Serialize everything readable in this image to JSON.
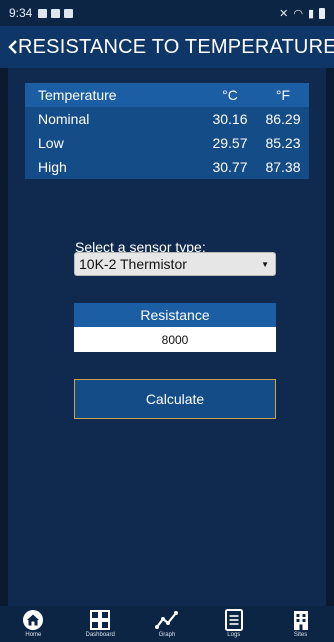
{
  "status_bar": {
    "time": "9:34"
  },
  "header": {
    "title": "RESISTANCE TO TEMPERATURE"
  },
  "table": {
    "headers": [
      "Temperature",
      "°C",
      "°F"
    ],
    "rows": [
      {
        "label": "Nominal",
        "c": "30.16",
        "f": "86.29"
      },
      {
        "label": "Low",
        "c": "29.57",
        "f": "85.23"
      },
      {
        "label": "High",
        "c": "30.77",
        "f": "87.38"
      }
    ]
  },
  "sensor": {
    "label": "Select a sensor type:",
    "selected": "10K-2 Thermistor"
  },
  "resistance": {
    "label": "Resistance",
    "value": "8000"
  },
  "calculate": {
    "label": "Calculate"
  },
  "nav": [
    {
      "label": "Home",
      "icon": "home-icon"
    },
    {
      "label": "Dashboard",
      "icon": "dashboard-icon"
    },
    {
      "label": "Graph",
      "icon": "graph-icon"
    },
    {
      "label": "Logs",
      "icon": "logs-icon"
    },
    {
      "label": "Sites",
      "icon": "sites-icon"
    }
  ]
}
